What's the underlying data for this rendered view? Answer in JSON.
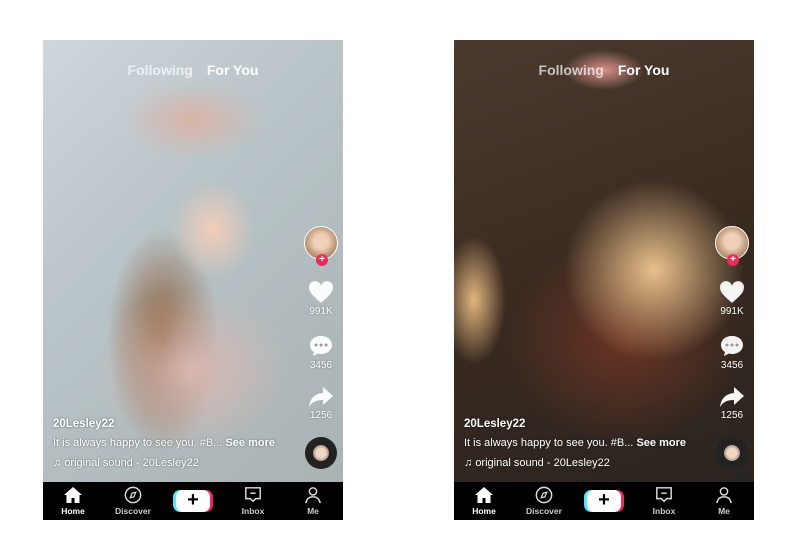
{
  "screens": [
    {
      "tabs": {
        "following": "Following",
        "for_you": "For You"
      },
      "likes": "991K",
      "comments": "3456",
      "shares": "1256",
      "username": "20Lesley22",
      "caption": "It is always happy to see you. #B...",
      "see_more": "See more",
      "sound": "original sound - 20Lesley22"
    },
    {
      "tabs": {
        "following": "Following",
        "for_you": "For You"
      },
      "likes": "991K",
      "comments": "3456",
      "shares": "1256",
      "username": "20Lesley22",
      "caption": "It is always happy to see you. #B...",
      "see_more": "See more",
      "sound": "original sound - 20Lesley22"
    }
  ],
  "nav": {
    "home": "Home",
    "discover": "Discover",
    "create": "+",
    "inbox": "Inbox",
    "me": "Me"
  },
  "colors": {
    "follow_plus": "#ee2a5a",
    "create_cyan": "#4de8f4",
    "create_red": "#f0285a",
    "nav_bg": "#000000"
  }
}
